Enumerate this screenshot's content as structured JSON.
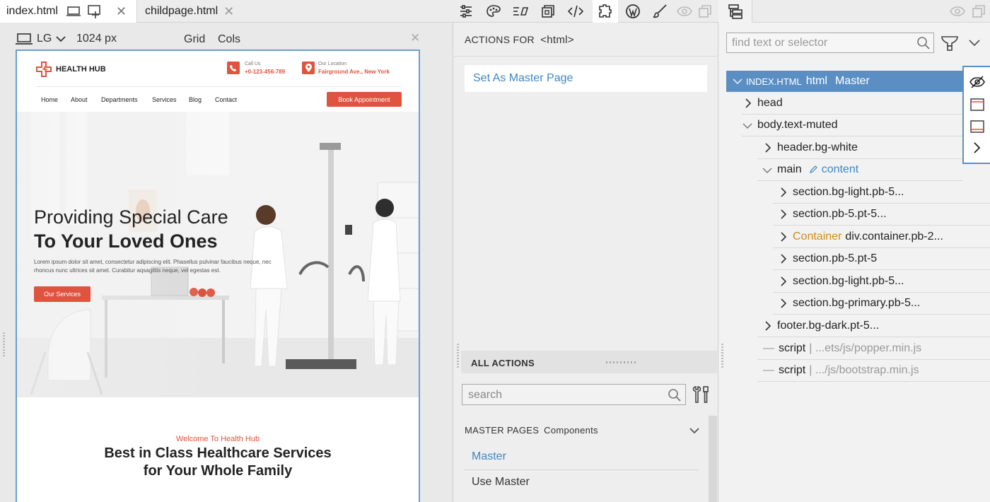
{
  "tabs": [
    {
      "label": "index.html"
    },
    {
      "label": "childpage.html"
    }
  ],
  "device": {
    "size": "LG",
    "width": "1024 px",
    "grid": "Grid",
    "cols": "Cols"
  },
  "site": {
    "brand": "HEALTH HUB",
    "call_label": "Call Us",
    "call_value": "+0-123-456-789",
    "location_label": "Our Location",
    "location_value": "Fairground Ave., New York",
    "nav": [
      "Home",
      "About",
      "Departments",
      "Services",
      "Blog",
      "Contact"
    ],
    "book_button": "Book Appointment",
    "hero_line1": "Providing Special Care",
    "hero_line2": "To Your Loved Ones",
    "hero_text_1": "Lorem ipsum dolor sit amet, consectetur adipiscing elit. Phasellus pulvinar faucibus neque, nec",
    "hero_text_2": "rhoncus nunc ultrices sit amet. Curabitur aqsagittis neque, vel egestas est.",
    "hero_button": "Our Services",
    "welcome": "Welcome To Health Hub",
    "heading_1": "Best in Class Healthcare Services",
    "heading_2": "for Your Whole Family"
  },
  "actions": {
    "title_prefix": "ACTIONS FOR",
    "title_tag": "<html>",
    "set_master": "Set As Master Page",
    "all_actions": "ALL ACTIONS",
    "search_placeholder": "search",
    "master_pages": "MASTER PAGES",
    "components": "Components",
    "items": [
      "Master",
      "Use Master"
    ]
  },
  "tree": {
    "search_placeholder": "find text or selector",
    "root_file": "INDEX.HTML",
    "root_tag": "html",
    "root_badge": "Master",
    "rows": [
      {
        "label": "head"
      },
      {
        "label": "body.text-muted"
      },
      {
        "label": "header.bg-white"
      },
      {
        "label": "main"
      },
      {
        "label": "content"
      },
      {
        "label": "section.bg-light.pb-5..."
      },
      {
        "label": "section.pb-5.pt-5..."
      },
      {
        "label": "Container"
      },
      {
        "label": "div.container.pb-2..."
      },
      {
        "label": "section.pb-5.pt-5"
      },
      {
        "label": "section.bg-light.pb-5..."
      },
      {
        "label": "section.bg-primary.pb-5..."
      },
      {
        "label": "footer.bg-dark.pt-5..."
      },
      {
        "label": "script"
      },
      {
        "label": "| ...ets/js/popper.min.js"
      },
      {
        "label": "script"
      },
      {
        "label": "| .../js/bootstrap.min.js"
      }
    ]
  },
  "colors": {
    "accent": "#e0533f",
    "selection": "#5b8fc4",
    "link": "#3e88c4",
    "container": "#d58b1c"
  }
}
